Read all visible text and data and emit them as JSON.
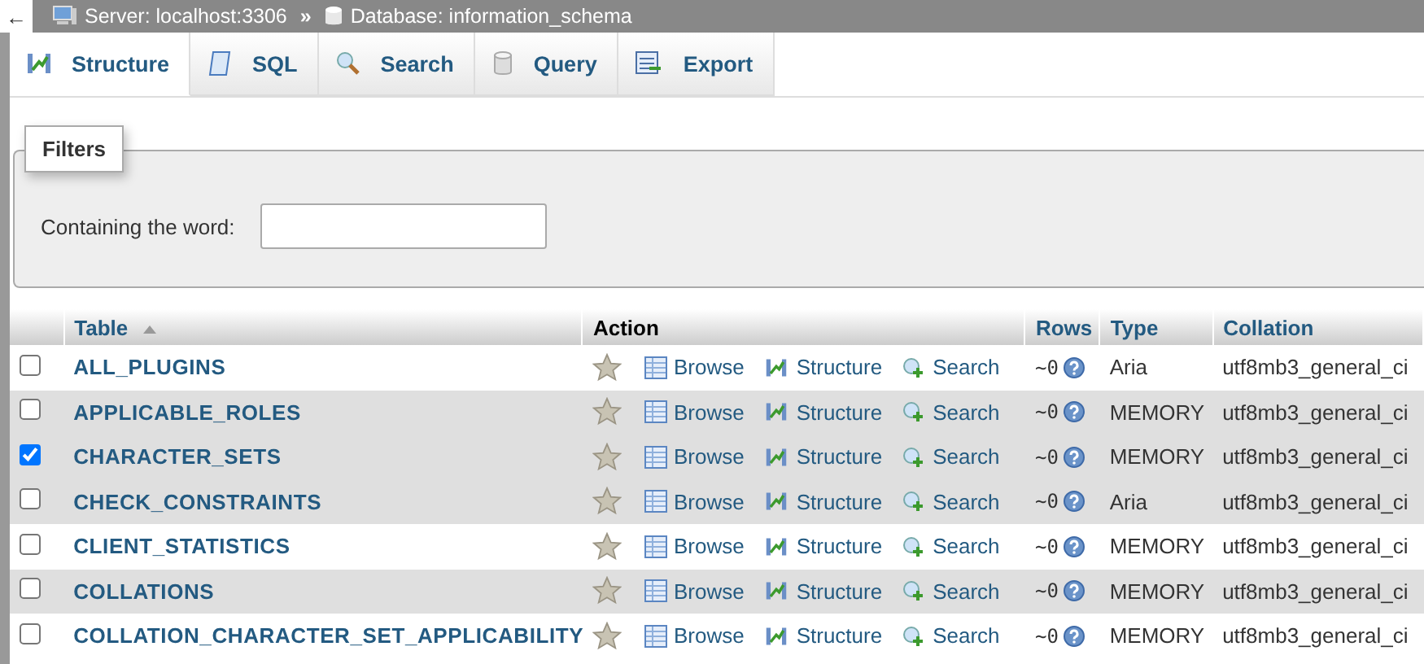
{
  "breadcrumb": {
    "back": "←",
    "items": [
      {
        "kind": "server",
        "label": "Server: localhost:3306"
      },
      {
        "kind": "database",
        "label": "Database: information_schema"
      }
    ],
    "separator": "»"
  },
  "tabs": [
    {
      "kind": "structure",
      "label": "Structure",
      "selected": true
    },
    {
      "kind": "sql",
      "label": "SQL",
      "selected": false
    },
    {
      "kind": "search",
      "label": "Search",
      "selected": false
    },
    {
      "kind": "query",
      "label": "Query",
      "selected": false
    },
    {
      "kind": "export",
      "label": "Export",
      "selected": false
    }
  ],
  "filters": {
    "legend": "Filters",
    "label": "Containing the word:"
  },
  "table": {
    "columns": [
      "Table",
      "Action",
      "Rows",
      "Type",
      "Collation"
    ],
    "rows": [
      {
        "name": "ALL_PLUGINS",
        "actions": [
          "Browse",
          "Structure",
          "Search"
        ],
        "checked": false,
        "rows": "~0",
        "type": "Aria",
        "collation": "utf8mb3_general_ci"
      },
      {
        "name": "APPLICABLE_ROLES",
        "actions": [
          "Browse",
          "Structure",
          "Search"
        ],
        "checked": false,
        "rows": "~0",
        "type": "MEMORY",
        "collation": "utf8mb3_general_ci"
      },
      {
        "name": "CHARACTER_SETS",
        "actions": [
          "Browse",
          "Structure",
          "Search"
        ],
        "checked": true,
        "rows": "~0",
        "type": "MEMORY",
        "collation": "utf8mb3_general_ci"
      },
      {
        "name": "CHECK_CONSTRAINTS",
        "actions": [
          "Browse",
          "Structure",
          "Search"
        ],
        "checked": false,
        "rows": "~0",
        "type": "Aria",
        "collation": "utf8mb3_general_ci"
      },
      {
        "name": "CLIENT_STATISTICS",
        "actions": [
          "Browse",
          "Structure",
          "Search"
        ],
        "checked": false,
        "rows": "~0",
        "type": "MEMORY",
        "collation": "utf8mb3_general_ci"
      },
      {
        "name": "COLLATIONS",
        "actions": [
          "Browse",
          "Structure",
          "Search"
        ],
        "checked": false,
        "rows": "~0",
        "type": "MEMORY",
        "collation": "utf8mb3_general_ci"
      },
      {
        "name": "COLLATION_CHARACTER_SET_APPLICABILITY",
        "actions": [
          "Browse",
          "Structure",
          "Search"
        ],
        "checked": false,
        "rows": "~0",
        "type": "MEMORY",
        "collation": "utf8mb3_general_ci"
      }
    ]
  }
}
